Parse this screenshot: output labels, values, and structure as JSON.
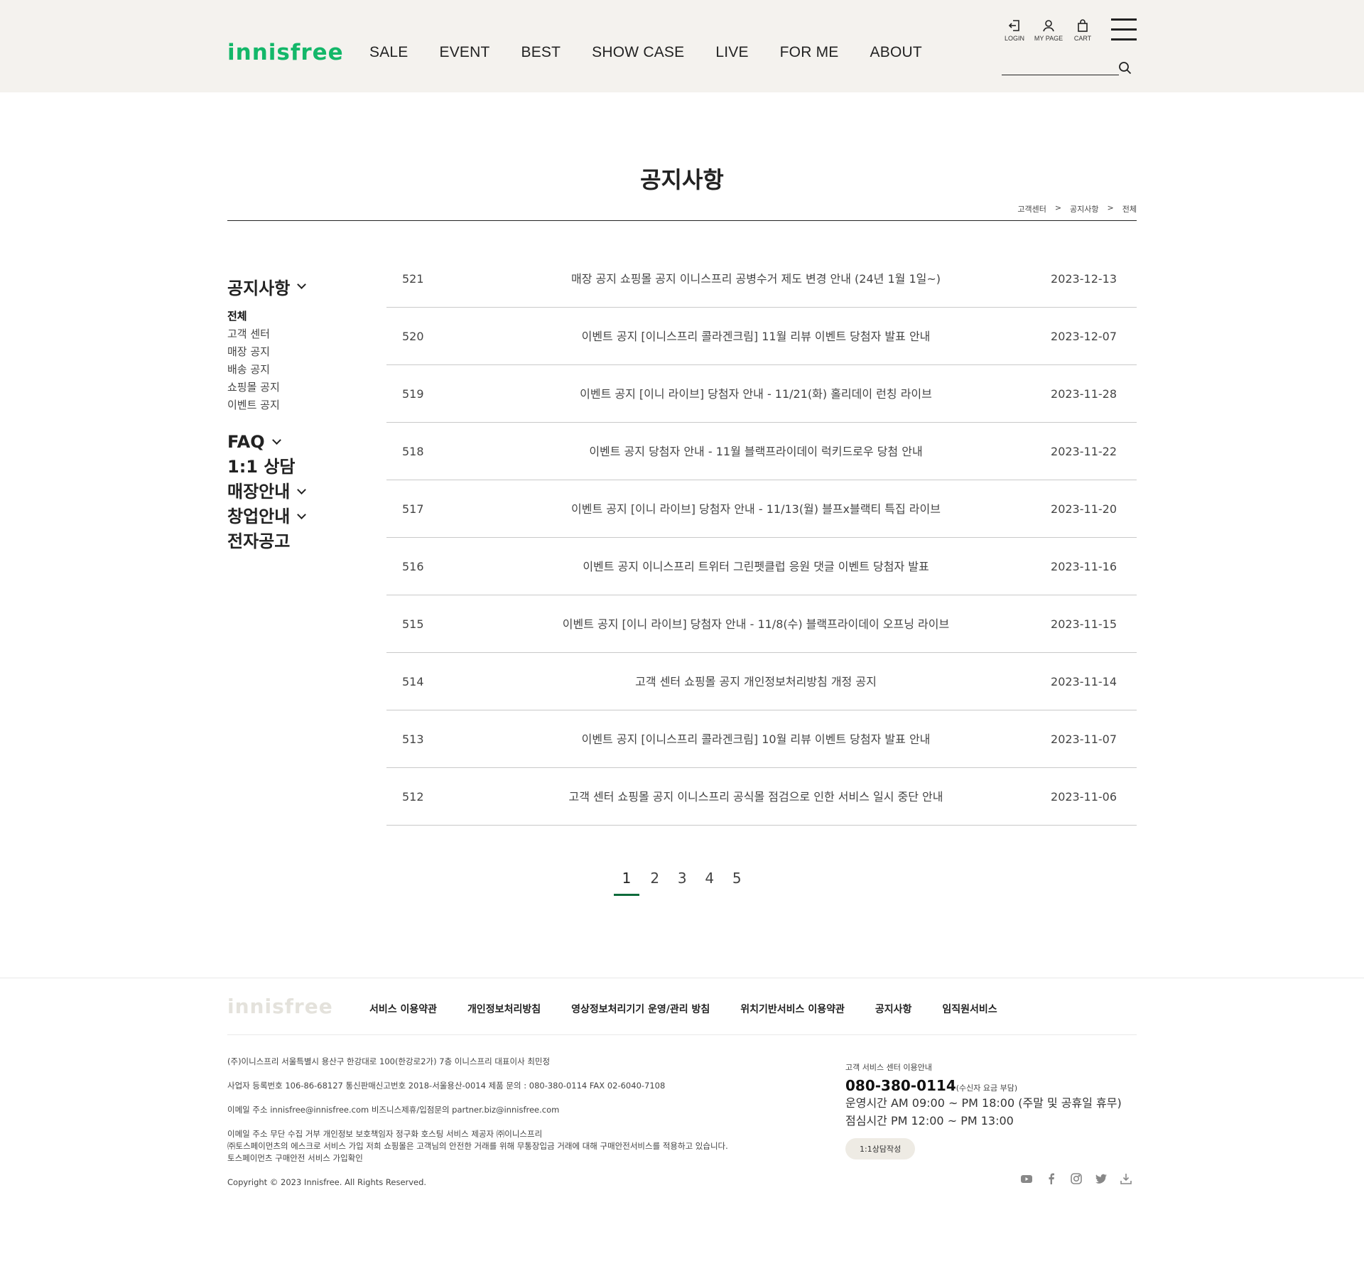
{
  "header": {
    "logo": "innisfree",
    "gnb": [
      "SALE",
      "EVENT",
      "BEST",
      "SHOW CASE",
      "LIVE",
      "FOR ME",
      "ABOUT"
    ],
    "util": {
      "login": "LOGIN",
      "mypage": "MY PAGE",
      "cart": "CART"
    }
  },
  "page": {
    "title": "공지사항",
    "breadcrumb": [
      "고객센터",
      "공지사항",
      "전체"
    ],
    "breadcrumb_sep": ">"
  },
  "side": {
    "notice_title": "공지사항",
    "notice_items": [
      "전체",
      "고객 센터",
      "매장 공지",
      "배송 공지",
      "쇼핑몰 공지",
      "이벤트 공지"
    ],
    "faq": "FAQ",
    "consult": "1:1 상담",
    "store": "매장안내",
    "startup": "창업안내",
    "announce": "전자공고"
  },
  "notices": [
    {
      "no": "521",
      "subject": "매장 공지 쇼핑몰 공지 이니스프리 공병수거 제도 변경 안내 (24년 1월 1일~)",
      "date": "2023-12-13"
    },
    {
      "no": "520",
      "subject": "이벤트 공지 [이니스프리 콜라겐크림] 11월 리뷰 이벤트 당첨자 발표 안내",
      "date": "2023-12-07"
    },
    {
      "no": "519",
      "subject": "이벤트 공지 [이니 라이브] 당첨자 안내 - 11/21(화) 홀리데이 런칭 라이브",
      "date": "2023-11-28"
    },
    {
      "no": "518",
      "subject": "이벤트 공지 당첨자 안내 - 11월 블랙프라이데이 럭키드로우 당첨 안내",
      "date": "2023-11-22"
    },
    {
      "no": "517",
      "subject": "이벤트 공지 [이니 라이브] 당첨자 안내 - 11/13(월) 블프x블랙티 특집 라이브",
      "date": "2023-11-20"
    },
    {
      "no": "516",
      "subject": "이벤트 공지 이니스프리 트위터 그린펫클럽 응원 댓글 이벤트 당첨자 발표",
      "date": "2023-11-16"
    },
    {
      "no": "515",
      "subject": "이벤트 공지 [이니 라이브] 당첨자 안내 - 11/8(수) 블랙프라이데이 오프닝 라이브",
      "date": "2023-11-15"
    },
    {
      "no": "514",
      "subject": "고객 센터 쇼핑몰 공지 개인정보처리방침 개정 공지",
      "date": "2023-11-14"
    },
    {
      "no": "513",
      "subject": "이벤트 공지 [이니스프리 콜라겐크림] 10월 리뷰 이벤트 당첨자 발표 안내",
      "date": "2023-11-07"
    },
    {
      "no": "512",
      "subject": "고객 센터 쇼핑몰 공지 이니스프리 공식몰 점검으로 인한 서비스 일시 중단 안내",
      "date": "2023-11-06"
    }
  ],
  "pagination": {
    "pages": [
      "1",
      "2",
      "3",
      "4",
      "5"
    ],
    "current": "1"
  },
  "footer": {
    "logo": "innisfree",
    "links": [
      "서비스 이용약관",
      "개인정보처리방침",
      "영상정보처리기기 운영/관리 방침",
      "위치기반서비스 이용약관",
      "공지사항",
      "임직원서비스"
    ],
    "company": "(주)이니스프리 서울특별시 용산구 한강대로 100(한강로2가) 7층 이니스프리 대표이사 최민정",
    "biz": "사업자 등록번호 106-86-68127 통신판매신고번호 2018-서울용산-0014 제품 문의 : 080-380-0114 FAX 02-6040-7108",
    "email": "이메일 주소 innisfree@innisfree.com 비즈니스제휴/입점문의 partner.biz@innisfree.com",
    "notice1": "이메일 주소 무단 수집 거부 개인정보 보호책임자 정구화 호스팅 서비스 제공자 ㈜이니스프리",
    "notice2": "㈜토스페이먼츠의 에스크로 서비스 가입 저희 쇼핑몰은 고객님의 안전한 거래를 위해 무통장입금 거래에 대해 구매안전서비스를 적용하고 있습니다.",
    "notice3": "토스페이먼츠 구매안전 서비스 가입확인",
    "copyright": "Copyright © 2023 Innisfree. All Rights Reserved.",
    "cs_label": "고객 서비스 센터 이용안내",
    "cs_tel": "080-380-0114",
    "cs_tel_note": "(수신자 요금 부담)",
    "cs_hours": "운영시간 AM 09:00 ~ PM 18:00 (주말 및 공휴일 휴무)",
    "cs_lunch": "점심시간 PM 12:00 ~ PM 13:00",
    "cs_button": "1:1상담작성",
    "sns": [
      "youtube-icon",
      "facebook-icon",
      "instagram-icon",
      "twitter-icon",
      "download-icon"
    ]
  },
  "colors": {
    "brand": "#13b769",
    "header_bg": "#f4f2ee",
    "pager_active": "#0e6b3b"
  }
}
